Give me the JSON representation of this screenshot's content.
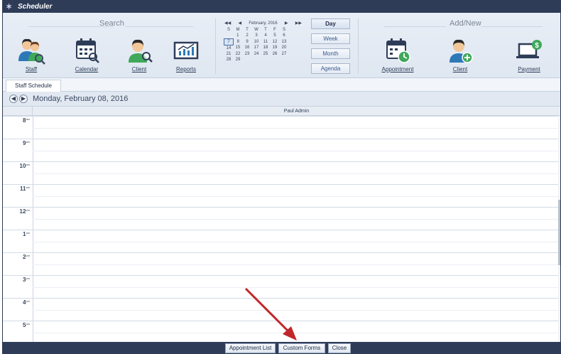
{
  "app": {
    "title": "Scheduler"
  },
  "ribbon": {
    "search": {
      "title": "Search",
      "items": [
        {
          "label": "Staff",
          "icon": "staff-search-icon"
        },
        {
          "label": "Calendar",
          "icon": "calendar-search-icon"
        },
        {
          "label": "Client",
          "icon": "client-search-icon"
        },
        {
          "label": "Reports",
          "icon": "reports-icon"
        }
      ]
    },
    "mini_calendar": {
      "nav_first": "◀◀",
      "nav_prev": "◀",
      "month_label": "February, 2016",
      "nav_next": "▶",
      "nav_last": "▶▶",
      "weekdays": [
        "S",
        "M",
        "T",
        "W",
        "T",
        "F",
        "S"
      ],
      "weeks": [
        [
          "",
          "1",
          "2",
          "3",
          "4",
          "5",
          "6"
        ],
        [
          "7",
          "8",
          "9",
          "10",
          "11",
          "12",
          "13"
        ],
        [
          "14",
          "15",
          "16",
          "17",
          "18",
          "19",
          "20"
        ],
        [
          "21",
          "22",
          "23",
          "24",
          "25",
          "26",
          "27"
        ],
        [
          "28",
          "29",
          "",
          "",
          "",
          "",
          ""
        ]
      ],
      "highlighted_day": "7"
    },
    "views": [
      {
        "label": "Day",
        "active": true
      },
      {
        "label": "Week",
        "active": false
      },
      {
        "label": "Month",
        "active": false
      },
      {
        "label": "Agenda",
        "active": false
      }
    ],
    "addnew": {
      "title": "Add/New",
      "items": [
        {
          "label": "Appointment",
          "icon": "appointment-add-icon"
        },
        {
          "label": "Client",
          "icon": "client-add-icon"
        },
        {
          "label": "Payment",
          "icon": "payment-icon"
        }
      ]
    }
  },
  "tabs": [
    {
      "label": "Staff Schedule"
    }
  ],
  "datebar": {
    "date": "Monday, February 08, 2016",
    "prev_icon": "arrow-left-icon",
    "next_icon": "arrow-right-icon"
  },
  "schedule": {
    "column_header": "Paul Admin",
    "hours": [
      {
        "h": "8",
        "ampm": "am"
      },
      {
        "h": "9",
        "ampm": "am"
      },
      {
        "h": "10",
        "ampm": "am"
      },
      {
        "h": "11",
        "ampm": "am"
      },
      {
        "h": "12",
        "ampm": "pm"
      },
      {
        "h": "1",
        "ampm": "pm"
      },
      {
        "h": "2",
        "ampm": "pm"
      },
      {
        "h": "3",
        "ampm": "pm"
      },
      {
        "h": "4",
        "ampm": "pm"
      },
      {
        "h": "5",
        "ampm": "pm"
      }
    ]
  },
  "bottom_buttons": [
    {
      "label": "Appointment List"
    },
    {
      "label": "Custom Forms"
    },
    {
      "label": "Close"
    }
  ],
  "colors": {
    "titlebar": "#2e3c57",
    "arrow": "#c0262a",
    "ribbon": "#e4ebf4"
  }
}
